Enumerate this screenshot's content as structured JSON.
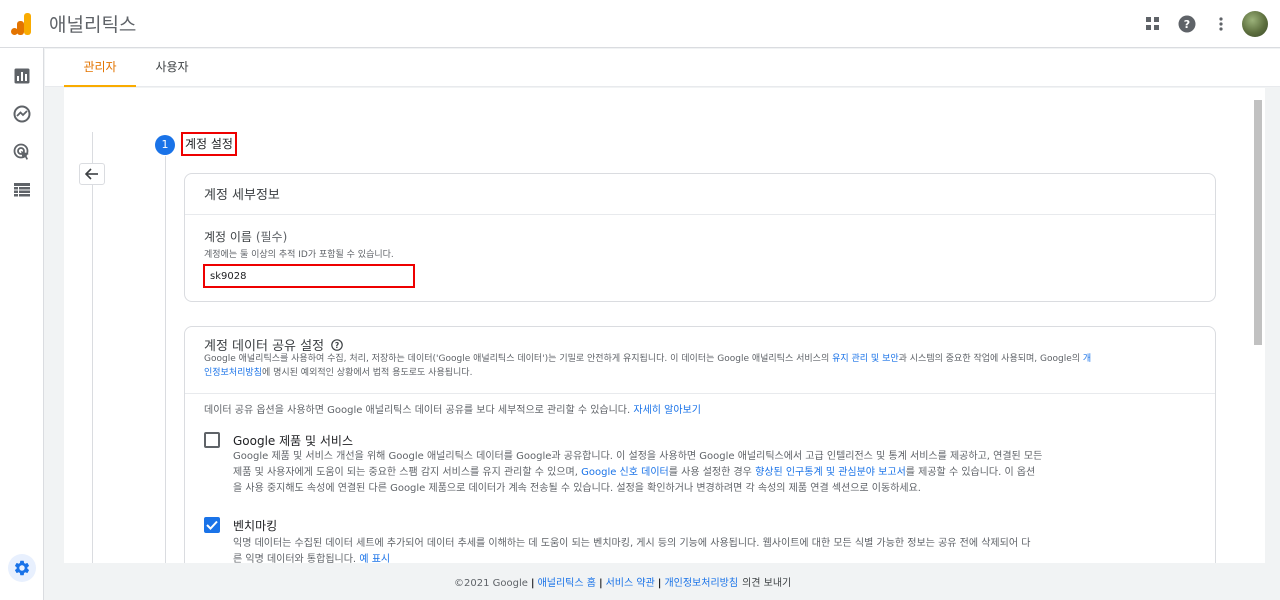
{
  "app": {
    "title": "애널리틱스"
  },
  "tabs": [
    {
      "label": "관리자",
      "active": true
    },
    {
      "label": "사용자",
      "active": false
    }
  ],
  "step": {
    "number": "1",
    "title": "계정 설정"
  },
  "account_details": {
    "card_title": "계정 세부정보",
    "name_label": "계정 이름",
    "name_required": "(필수)",
    "name_hint": "계정에는 둘 이상의 추적 ID가 포함될 수 있습니다.",
    "name_value": "sk9028"
  },
  "data_sharing": {
    "card_title": "계정 데이터 공유 설정",
    "desc_part1": "Google 애널리틱스를 사용하여 수집, 처리, 저장하는 데이터('Google 애널리틱스 데이터')는 기밀로 안전하게 유지됩니다. 이 데이터는 Google 애널리틱스 서비스의 ",
    "desc_link1": "유지 관리 및 보안",
    "desc_part2": "과 시스템의 중요한 작업에 사용되며, Google의 ",
    "desc_link2a": "개",
    "desc_link2b": "인정보처리방침",
    "desc_part3": "에 명시된 예외적인 상황에서 법적 용도로도 사용됩니다.",
    "intro_text": "데이터 공유 옵션을 사용하면 Google 애널리틱스 데이터 공유를 보다 세부적으로 관리할 수 있습니다.",
    "intro_link": "자세히 알아보기",
    "options": [
      {
        "title": "Google 제품 및 서비스",
        "checked": false,
        "line1": "Google 제품 및 서비스 개선을 위해 Google 애널리틱스 데이터를 Google과 공유합니다. 이 설정을 사용하면 Google 애널리틱스에서 고급 인텔리전스 및 통계 서비스를 제공하고, 연결된 모든",
        "line2_a": "제품 및 사용자에게 도움이 되는 중요한 스팸 감지 서비스를 유지 관리할 수 있으며, ",
        "line2_link1": "Google 신호 데이터",
        "line2_b": "를 사용 설정한 경우 ",
        "line2_link2": "향상된 인구통계 및 관심분야 보고서",
        "line2_c": "를 제공할 수 있습니다. 이 옵션",
        "line3": "을 사용 중지해도 속성에 연결된 다른 Google 제품으로 데이터가 계속 전송될 수 있습니다. 설정을 확인하거나 변경하려면 각 속성의 제품 연결 섹션으로 이동하세요."
      },
      {
        "title": "벤치마킹",
        "checked": true,
        "line1": "익명 데이터는 수집된 데이터 세트에 추가되어 데이터 추세를 이해하는 데 도움이 되는 벤치마킹, 게시 등의 기능에 사용됩니다. 웹사이트에 대한 모든 식별 가능한 정보는 공유 전에 삭제되어 다",
        "line2": "른 익명 데이터와 통합됩니다.",
        "link": "예 표시"
      }
    ]
  },
  "footer": {
    "copyright": "©2021 Google",
    "links": [
      "애널리틱스 홈",
      "서비스 약관",
      "개인정보처리방침"
    ],
    "feedback": "의견 보내기"
  },
  "colors": {
    "accent": "#f9ab00",
    "link": "#1a73e8",
    "highlight": "#e00000"
  },
  "icons": [
    "apps-icon",
    "help-icon",
    "more-vert-icon",
    "bar-chart-icon",
    "explore-icon",
    "advertising-icon",
    "table-icon",
    "gear-icon",
    "back-arrow-icon",
    "help-circle-icon",
    "check-icon"
  ]
}
